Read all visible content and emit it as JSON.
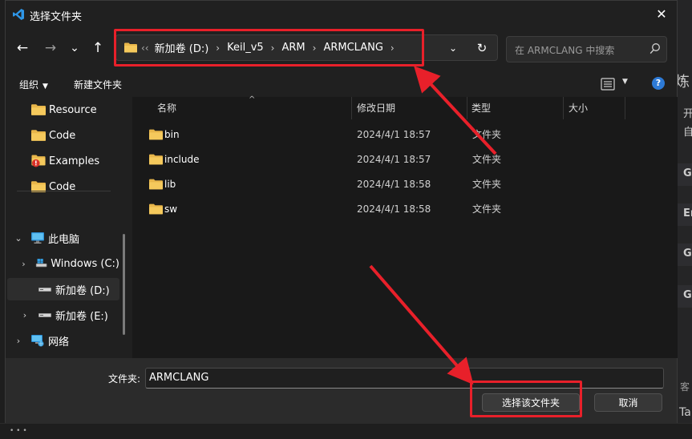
{
  "dialog": {
    "title": "选择文件夹",
    "close_glyph": "✕"
  },
  "nav": {
    "back": "←",
    "forward": "→",
    "recent": "⌄",
    "up": "↑"
  },
  "address": {
    "overflow_glyph": "‹‹",
    "crumbs": [
      "新加卷 (D:)",
      "Keil_v5",
      "ARM",
      "ARMCLANG"
    ],
    "separator": "›",
    "dropdown_glyph": "⌄",
    "refresh_glyph": "↻"
  },
  "search": {
    "placeholder": "在 ARMCLANG 中搜索"
  },
  "commands": {
    "organize": "组织",
    "organize_dd": "▼",
    "new_folder": "新建文件夹",
    "view_dd": "▼",
    "help": "?"
  },
  "sidebar": {
    "quick": [
      {
        "label": "Resource",
        "icon": "folder-icon"
      },
      {
        "label": "Code",
        "icon": "folder-icon"
      },
      {
        "label": "Examples",
        "icon": "folder-warning-icon"
      },
      {
        "label": "Code",
        "icon": "folder-icon"
      }
    ],
    "this_pc": "此电脑",
    "drives": [
      {
        "label": "Windows (C:)"
      },
      {
        "label": "新加卷 (D:)"
      },
      {
        "label": "新加卷 (E:)"
      }
    ],
    "network": "网络",
    "expanded_glyph": "⌄",
    "collapsed_glyph": "›"
  },
  "columns": {
    "name": "名称",
    "modified": "修改日期",
    "type": "类型",
    "size": "大小",
    "sort_glyph": "^"
  },
  "files": [
    {
      "name": "bin",
      "modified": "2024/4/1 18:57",
      "type": "文件夹",
      "size": ""
    },
    {
      "name": "include",
      "modified": "2024/4/1 18:57",
      "type": "文件夹",
      "size": ""
    },
    {
      "name": "lib",
      "modified": "2024/4/1 18:58",
      "type": "文件夹",
      "size": ""
    },
    {
      "name": "sw",
      "modified": "2024/4/1 18:58",
      "type": "文件夹",
      "size": ""
    }
  ],
  "footer": {
    "folder_label": "文件夹:",
    "folder_value": "ARMCLANG",
    "select_button": "选择该文件夹",
    "cancel_button": "取消"
  },
  "background": {
    "snippets": [
      "炼",
      "开",
      "自",
      "G",
      "Er",
      "G",
      "G",
      "客",
      "Ta"
    ],
    "dots": "• • •"
  },
  "colors": {
    "accent": "#2d7ad6",
    "folder": "#e8b64a",
    "annotation_red": "#e8202a"
  }
}
